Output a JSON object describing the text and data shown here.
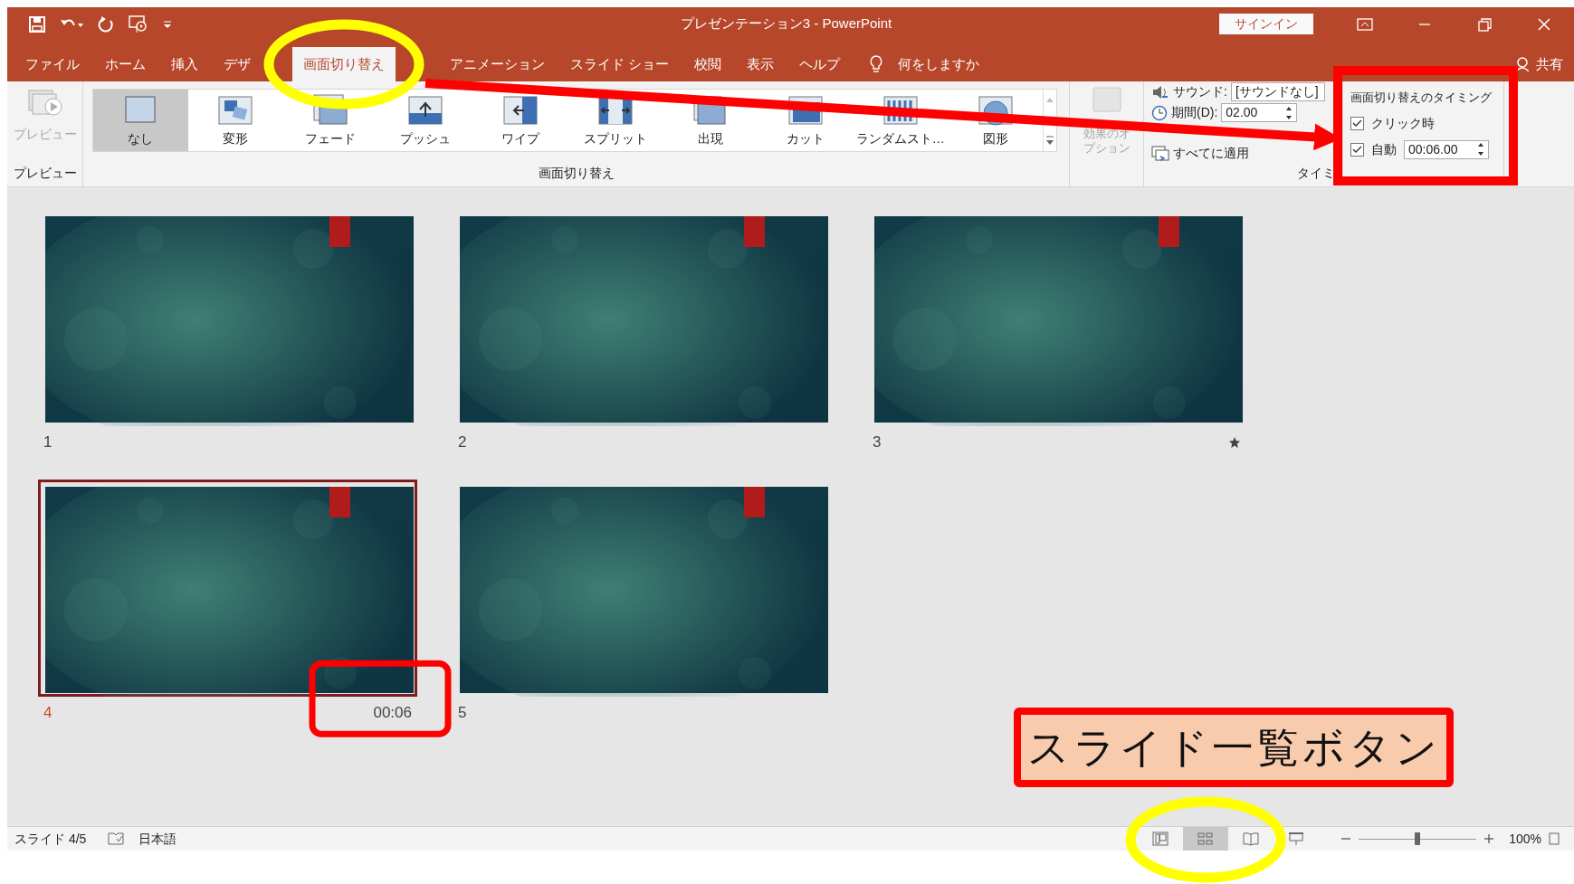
{
  "window": {
    "title": "プレゼンテーション3 - PowerPoint",
    "sign_in": "サインイン"
  },
  "tabs": [
    {
      "label": "ファイル",
      "selected": false
    },
    {
      "label": "ホーム",
      "selected": false
    },
    {
      "label": "挿入",
      "selected": false
    },
    {
      "label": "デザ",
      "selected": false
    },
    {
      "label": "画面切り替え",
      "selected": true
    },
    {
      "label": "アニメーション",
      "selected": false
    },
    {
      "label": "スライド ショー",
      "selected": false
    },
    {
      "label": "校閲",
      "selected": false
    },
    {
      "label": "表示",
      "selected": false
    },
    {
      "label": "ヘルプ",
      "selected": false
    }
  ],
  "tell_me": "何をしますか",
  "share": "共有",
  "ribbon": {
    "preview": {
      "label": "プレビュー",
      "disabled": true
    },
    "preview_group": "プレビュー",
    "transitions": [
      {
        "label": "なし",
        "selected": true
      },
      {
        "label": "変形",
        "selected": false
      },
      {
        "label": "フェード",
        "selected": false
      },
      {
        "label": "プッシュ",
        "selected": false
      },
      {
        "label": "ワイプ",
        "selected": false
      },
      {
        "label": "スプリット",
        "selected": false
      },
      {
        "label": "出現",
        "selected": false
      },
      {
        "label": "カット",
        "selected": false
      },
      {
        "label": "ランダムスト…",
        "selected": false
      },
      {
        "label": "図形",
        "selected": false
      }
    ],
    "transitions_group": "画面切り替え",
    "effect_options": {
      "label": "効果のオプション",
      "disabled": true
    },
    "sound": {
      "label": "サウンド:",
      "value": "[サウンドなし]"
    },
    "duration": {
      "label": "期間(D):",
      "value": "02.00"
    },
    "apply_all": "すべてに適用",
    "timing_group": "タイミ",
    "advance": {
      "title": "画面切り替えのタイミング",
      "on_click": {
        "label": "クリック時",
        "checked": true
      },
      "after": {
        "label": "自動",
        "checked": true,
        "value": "00:06.00"
      }
    }
  },
  "slides": [
    {
      "number": "1",
      "selected": false,
      "starred": false
    },
    {
      "number": "2",
      "selected": false,
      "starred": false
    },
    {
      "number": "3",
      "selected": false,
      "starred": true
    },
    {
      "number": "4",
      "selected": true,
      "starred": false,
      "timing": "00:06"
    },
    {
      "number": "5",
      "selected": false,
      "starred": false
    }
  ],
  "callout": "スライド一覧ボタン",
  "status_bar": {
    "slide": "スライド 4/5",
    "language": "日本語",
    "views": [
      {
        "kind": "normal",
        "selected": false
      },
      {
        "kind": "sorter",
        "selected": true
      },
      {
        "kind": "reading",
        "selected": false
      }
    ],
    "zoom": {
      "level": 0.5,
      "reading": "100%"
    }
  }
}
